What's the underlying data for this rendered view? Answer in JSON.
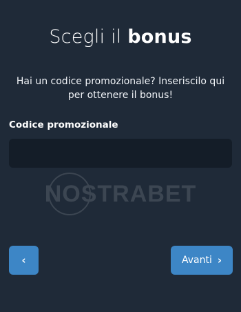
{
  "header": {
    "title_prefix": "Scegli il ",
    "title_emphasis": "bonus",
    "subtitle": "Hai un codice promozionale? Inseriscilo qui per ottenere il bonus!"
  },
  "form": {
    "promo_label": "Codice promozionale",
    "promo_value": "",
    "promo_placeholder": ""
  },
  "watermark": {
    "text": "NOSTRABET"
  },
  "navigation": {
    "back_icon": "‹",
    "next_label": "Avanti",
    "next_icon": "›"
  },
  "colors": {
    "background": "#1f2a38",
    "input_background": "#141d28",
    "button": "#3d86c6",
    "text": "#ffffff"
  }
}
